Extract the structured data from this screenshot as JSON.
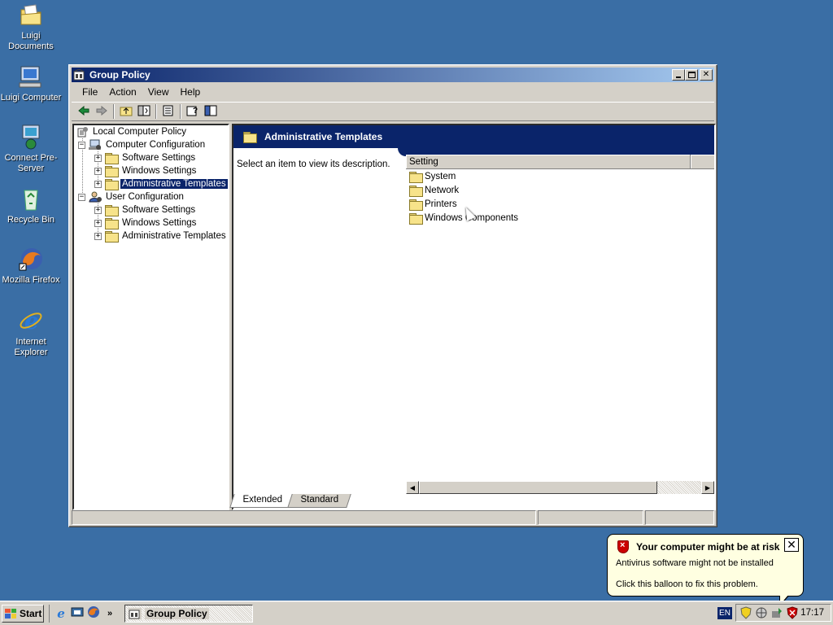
{
  "desktop": {
    "icons": [
      {
        "label": "Luigi Documents"
      },
      {
        "label": "Luigi Computer"
      },
      {
        "label": "Connect Pre-Server"
      },
      {
        "label": "Recycle Bin"
      },
      {
        "label": "Mozilla Firefox"
      },
      {
        "label": "Internet Explorer"
      }
    ]
  },
  "window": {
    "title": "Group Policy",
    "menu": [
      "File",
      "Action",
      "View",
      "Help"
    ],
    "tree": [
      {
        "label": "Local Computer Policy"
      },
      {
        "label": "Computer Configuration"
      },
      {
        "label": "Software Settings"
      },
      {
        "label": "Windows Settings"
      },
      {
        "label": "Administrative Templates"
      },
      {
        "label": "User Configuration"
      },
      {
        "label": "Software Settings"
      },
      {
        "label": "Windows Settings"
      },
      {
        "label": "Administrative Templates"
      }
    ],
    "right": {
      "header": "Administrative Templates",
      "description": "Select an item to view its description.",
      "column": "Setting",
      "items": [
        "System",
        "Network",
        "Printers",
        "Windows Components"
      ]
    },
    "tabs": [
      "Extended",
      "Standard"
    ]
  },
  "balloon": {
    "title": "Your computer might be at risk",
    "line1": "Antivirus software might not be installed",
    "line2": "Click this balloon to fix this problem."
  },
  "taskbar": {
    "start": "Start",
    "task": "Group Policy",
    "lang": "EN",
    "clock": "17:17"
  },
  "colors": {
    "desktop": "#3a6ea5",
    "titlebar": "#0a246a",
    "selection": "#0a246a"
  }
}
